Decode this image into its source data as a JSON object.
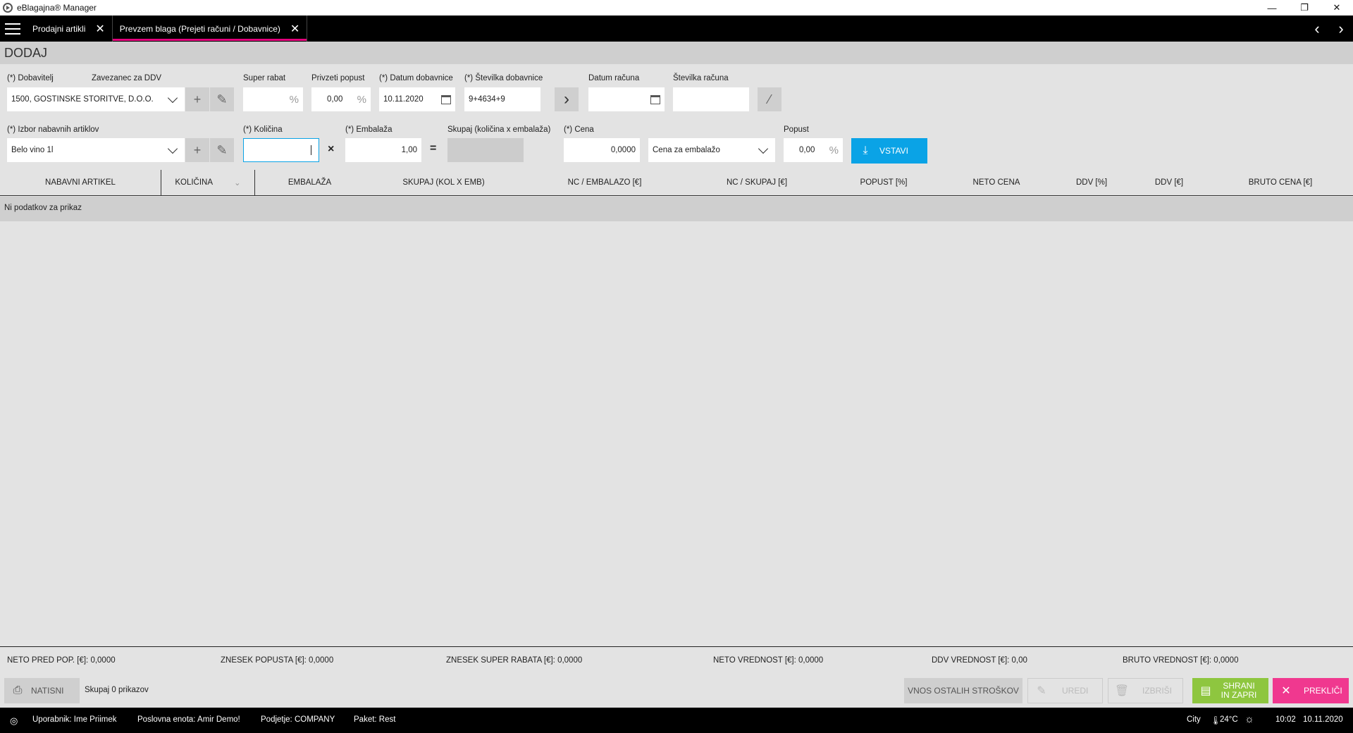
{
  "window": {
    "title": "eBlagajna® Manager",
    "minimize": "—",
    "restore": "❐",
    "close": "✕"
  },
  "tabs": [
    {
      "label": "Prodajni artikli",
      "close": "✕"
    },
    {
      "label": "Prevzem blaga (Prejeti računi / Dobavnice)",
      "close": "✕"
    }
  ],
  "nav": {
    "prev": "‹",
    "next": "›"
  },
  "section_title": "DODAJ",
  "form": {
    "dobavitelj_label": "(*) Dobavitelj",
    "zavezanec_label": "Zavezanec za DDV",
    "dobavitelj_value": "1500, GOSTINSKE STORITVE, D.O.O.",
    "super_rabat_label": "Super rabat",
    "super_rabat_suffix": "%",
    "privzeti_popust_label": "Privzeti popust",
    "privzeti_popust_value": "0,00",
    "privzeti_popust_suffix": "%",
    "datum_dobavnice_label": "(*) Datum dobavnice",
    "datum_dobavnice_value": "10.11.2020",
    "stevilka_dobavnice_label": "(*) Številka dobavnice",
    "stevilka_dobavnice_value": "9+4634+9",
    "next_glyph": "›",
    "datum_racuna_label": "Datum računa",
    "stevilka_racuna_label": "Številka računa",
    "izbor_label": "(*) Izbor nabavnih artiklov",
    "izbor_value": "Belo vino 1l",
    "kolicina_label": "(*) Količina",
    "embalaza_label": "(*) Embalaža",
    "embalaza_value": "1,00",
    "skupaj_label": "Skupaj (količina x embalaža)",
    "cena_label": "(*) Cena",
    "cena_value": "0,0000",
    "cena_tip_value": "Cena za embalažo",
    "popust_label": "Popust",
    "popust_value": "0,00",
    "popust_suffix": "%",
    "times": "×",
    "equals": "=",
    "plus": "+",
    "vstavi_label": "VSTAVI"
  },
  "table": {
    "columns": [
      "NABAVNI ARTIKEL",
      "KOLIČINA",
      "EMBALAŽA",
      "SKUPAJ (KOL X EMB)",
      "NC / EMBALAZO [€]",
      "NC / SKUPAJ [€]",
      "POPUST [%]",
      "NETO CENA",
      "DDV [%]",
      "DDV [€]",
      "BRUTO CENA [€]"
    ],
    "empty_text": "Ni podatkov za prikaz"
  },
  "totals": {
    "neto_pred_pop": "NETO PRED POP. [€]: 0,0000",
    "znesek_popusta": "ZNESEK POPUSTA [€]: 0,0000",
    "znesek_super_rabata": "ZNESEK SUPER RABATA [€]: 0,0000",
    "neto_vrednost": "NETO VREDNOST [€]: 0,0000",
    "ddv_vrednost": "DDV VREDNOST [€]: 0,00",
    "bruto_vrednost": "BRUTO VREDNOST [€]: 0,0000"
  },
  "footer": {
    "natisni": "NATISNI",
    "count": "Skupaj 0 prikazov",
    "vnos": "VNOS OSTALIH STROŠKOV",
    "uredi": "UREDI",
    "izbrisi": "IZBRIŠI",
    "shrani": "SHRANI IN ZAPRI",
    "preklici": "PREKLIČI"
  },
  "status": {
    "uporabnik": "Uporabnik: Ime Priimek",
    "enota": "Poslovna enota: Amir Demo!",
    "podjetje": "Podjetje: COMPANY",
    "paket": "Paket: Rest",
    "city": "City",
    "temp": "24°C",
    "time": "10:02",
    "date": "10.11.2020"
  }
}
